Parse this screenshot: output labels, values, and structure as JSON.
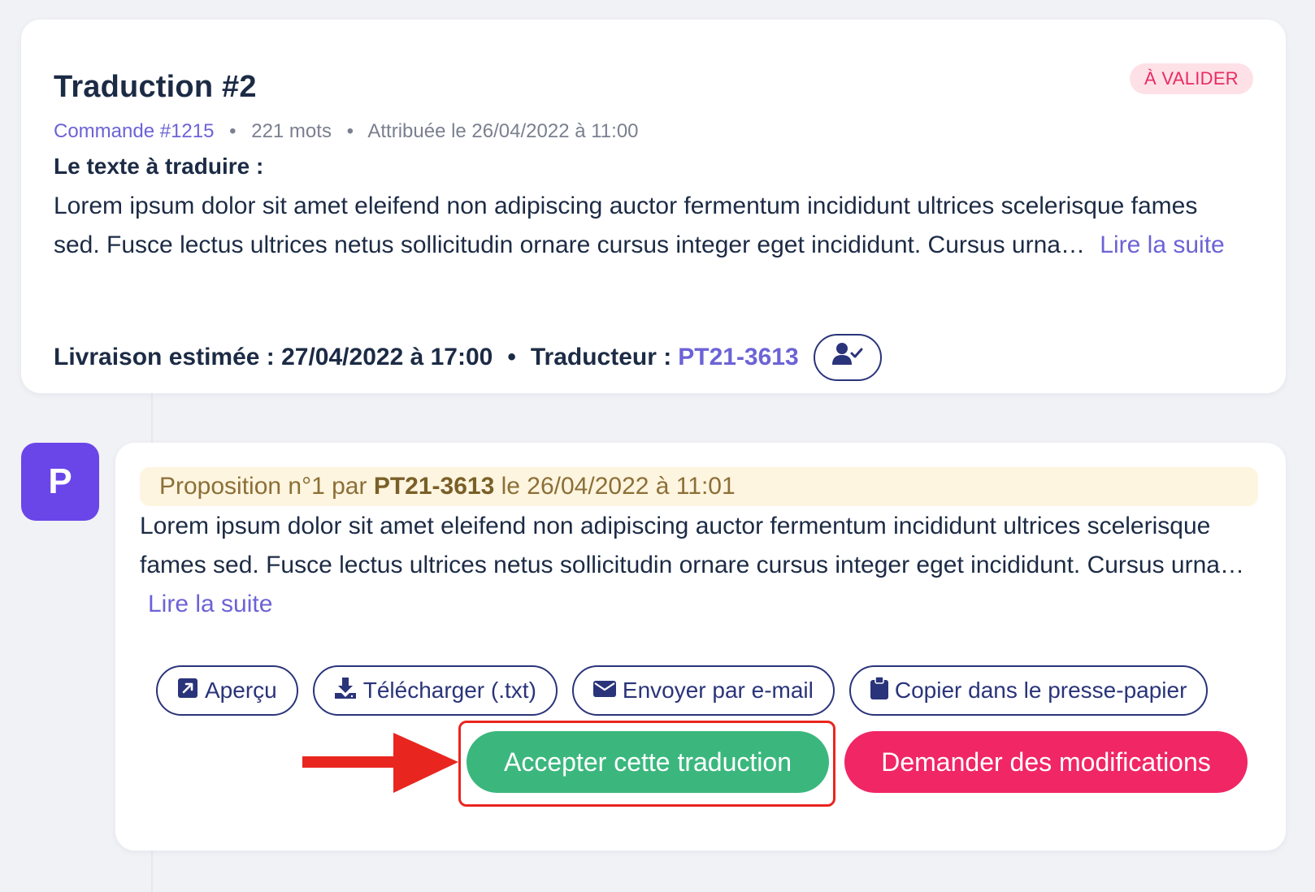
{
  "task": {
    "title": "Traduction #2",
    "status": "À VALIDER",
    "order_link": "Commande #1215",
    "word_count": "221 mots",
    "assigned": "Attribuée le 26/04/2022 à 11:00",
    "meta_separator": "•",
    "text_label": "Le texte à traduire :",
    "text_excerpt": "Lorem ipsum dolor sit amet eleifend non adipiscing auctor fermentum incididunt ultrices scelerisque fames sed. Fusce lectus ultrices netus sollicitudin ornare cursus integer eget incididunt. Cursus urna…",
    "read_more": "Lire la suite",
    "delivery": "Livraison estimée : 27/04/2022 à 17:00",
    "delivery_separator": "•",
    "translator_label": "Traducteur :",
    "translator_id": "PT21-3613",
    "assign_icon": "user-check-icon"
  },
  "proposal": {
    "avatar_letter": "P",
    "header_prefix": "Proposition n°1 par",
    "header_author": "PT21-3613",
    "header_suffix": "le 26/04/2022 à 11:01",
    "text_excerpt": "Lorem ipsum dolor sit amet eleifend non adipiscing auctor fermentum incididunt ultrices scelerisque fames sed. Fusce lectus ultrices netus sollicitudin ornare cursus integer eget incididunt. Cursus urna…",
    "read_more": "Lire la suite",
    "actions": {
      "preview": "Aperçu",
      "download": "Télécharger (.txt)",
      "email": "Envoyer par e-mail",
      "copy": "Copier dans le presse-papier"
    },
    "accept": "Accepter cette traduction",
    "request_changes": "Demander des modifications"
  },
  "colors": {
    "accent": "#6c63d6",
    "navy": "#2a347a",
    "accept": "#3bb77e",
    "reject": "#f02665",
    "annotation": "#e8261f",
    "avatar": "#6a45e8"
  }
}
